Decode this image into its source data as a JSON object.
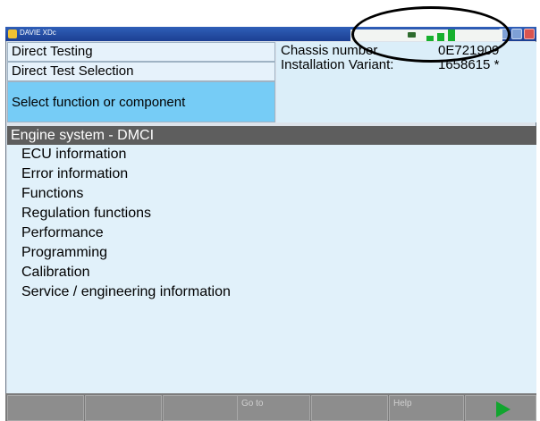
{
  "window": {
    "title": "DAVIE XDc"
  },
  "status": {
    "indicators": [
      "truck-icon",
      "signal-bar-1",
      "signal-bar-2",
      "signal-bar-3"
    ],
    "color": "#17b02e"
  },
  "panels": {
    "direct_testing": "Direct Testing",
    "direct_test_selection": "Direct Test Selection",
    "select_function": "Select function or component"
  },
  "vehicle": {
    "chassis_label": "Chassis number",
    "chassis_value": "0E721909",
    "variant_label": "Installation Variant:",
    "variant_value": "1658615 *"
  },
  "list": {
    "header": "Engine system - DMCI",
    "items": [
      "ECU information",
      "Error information",
      "Functions",
      "Regulation functions",
      "Performance",
      "Programming",
      "Calibration",
      "Service / engineering information"
    ]
  },
  "footer": {
    "goto_label": "Go to",
    "help_label": "Help"
  },
  "colors": {
    "selected_panel": "#76ccf6",
    "header_bar": "#5e5e5e",
    "list_bg": "#e1f1fa",
    "play": "#12a52f"
  }
}
